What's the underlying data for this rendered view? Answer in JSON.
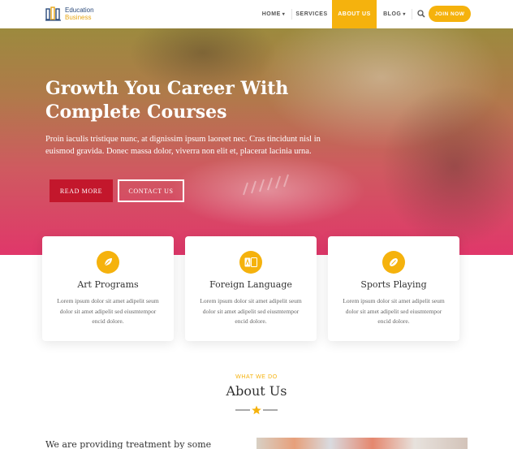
{
  "brand": {
    "line1": "Education",
    "line2": "Business"
  },
  "nav": {
    "items": [
      {
        "label": "HOME",
        "has_dropdown": true
      },
      {
        "label": "SERVICES",
        "has_dropdown": false
      },
      {
        "label": "ABOUT US",
        "has_dropdown": false,
        "active": true
      },
      {
        "label": "BLOG",
        "has_dropdown": true
      }
    ],
    "search_icon": "search-icon",
    "cta_label": "JOIN NOW"
  },
  "hero": {
    "title": "Growth You Career With Complete Courses",
    "text": "Proin iaculis tristique nunc, at dignissim ipsum laoreet nec. Cras tincidunt nisl in euismod gravida. Donec massa dolor, viverra non elit et, placerat lacinia urna.",
    "primary_button": "READ MORE",
    "secondary_button": "CONTACT US"
  },
  "features": [
    {
      "icon": "leaf-icon",
      "title": "Art Programs",
      "text": "Lorem ipsum dolor sit amet adipelit seum dolor sit amet adipelit sed eiusmtempor encid dolore."
    },
    {
      "icon": "language-icon",
      "title": "Foreign Language",
      "text": "Lorem ipsum dolor sit amet adipelit seum dolor sit amet adipelit sed eiusmtempor encid dolore."
    },
    {
      "icon": "football-icon",
      "title": "Sports Playing",
      "text": "Lorem ipsum dolor sit amet adipelit seum dolor sit amet adipelit sed eiusmtempor encid dolore."
    }
  ],
  "about": {
    "kicker": "WHAT WE DO",
    "title": "About Us",
    "intro_heading": "We are providing treatment by some"
  },
  "colors": {
    "accent": "#f5b20d",
    "primary_button": "#c3172c",
    "brand_blue": "#2b4a7a",
    "hero_top": "#9c8a3e",
    "hero_bottom": "#e0376a"
  }
}
